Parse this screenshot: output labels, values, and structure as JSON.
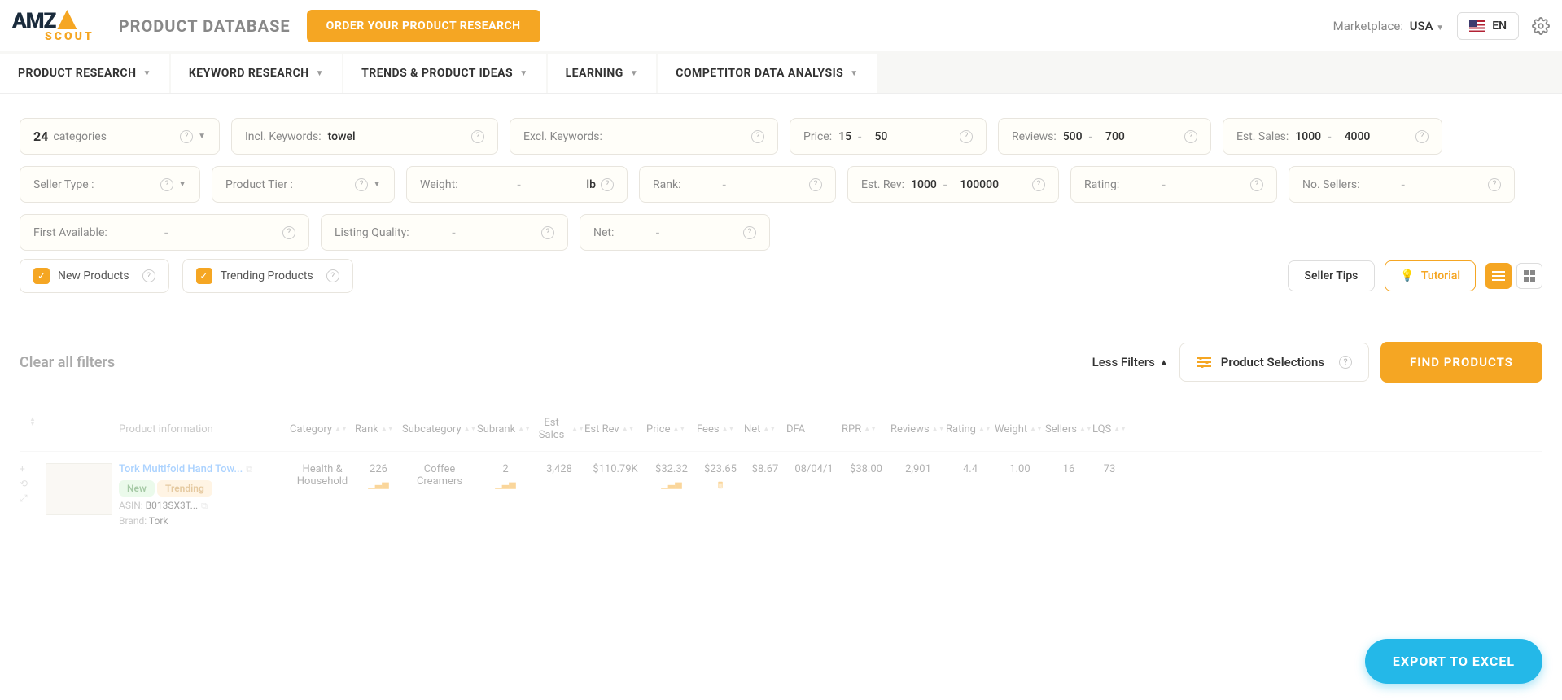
{
  "header": {
    "logo_text1": "AMZ",
    "logo_text2": "SCOUT",
    "page_title": "PRODUCT DATABASE",
    "order_btn": "ORDER YOUR PRODUCT RESEARCH",
    "marketplace_label": "Marketplace:",
    "marketplace_value": "USA",
    "lang": "EN"
  },
  "nav": {
    "items": [
      "PRODUCT RESEARCH",
      "KEYWORD RESEARCH",
      "TRENDS & PRODUCT IDEAS",
      "LEARNING",
      "COMPETITOR DATA ANALYSIS"
    ]
  },
  "filters": {
    "categories_count": "24",
    "categories_label": "categories",
    "incl_kw_label": "Incl. Keywords:",
    "incl_kw_value": "towel",
    "excl_kw_label": "Excl. Keywords:",
    "price_label": "Price:",
    "price_min": "15",
    "price_max": "50",
    "reviews_label": "Reviews:",
    "reviews_min": "500",
    "reviews_max": "700",
    "est_sales_label": "Est. Sales:",
    "est_sales_min": "1000",
    "est_sales_max": "4000",
    "seller_type_label": "Seller Type :",
    "product_tier_label": "Product Tier :",
    "weight_label": "Weight:",
    "weight_unit": "lb",
    "rank_label": "Rank:",
    "est_rev_label": "Est. Rev:",
    "est_rev_min": "1000",
    "est_rev_max": "100000",
    "rating_label": "Rating:",
    "no_sellers_label": "No. Sellers:",
    "first_avail_label": "First Available:",
    "listing_quality_label": "Listing Quality:",
    "net_label": "Net:"
  },
  "checkboxes": {
    "new_products": "New Products",
    "trending_products": "Trending Products",
    "seller_tips": "Seller Tips",
    "tutorial": "Tutorial"
  },
  "actions": {
    "clear_filters": "Clear all filters",
    "less_filters": "Less Filters",
    "product_selections": "Product Selections",
    "find_products": "FIND PRODUCTS"
  },
  "table": {
    "headers": {
      "product_info": "Product information",
      "category": "Category",
      "rank": "Rank",
      "subcategory": "Subcategory",
      "subrank": "Subrank",
      "est_sales": "Est Sales",
      "est_rev": "Est Rev",
      "price": "Price",
      "fees": "Fees",
      "net": "Net",
      "dfa": "DFA",
      "rpr": "RPR",
      "reviews": "Reviews",
      "rating": "Rating",
      "weight": "Weight",
      "sellers": "Sellers",
      "lqs": "LQS"
    },
    "row": {
      "product_name": "Tork Multifold Hand Tow...",
      "badge_new": "New",
      "badge_trending": "Trending",
      "asin_label": "ASIN:",
      "asin_value": "B013SX3T...",
      "brand_label": "Brand:",
      "brand_value": "Tork",
      "category": "Health & Household",
      "rank": "226",
      "subcategory": "Coffee Creamers",
      "subrank": "2",
      "est_sales": "3,428",
      "est_rev": "$110.79K",
      "price": "$32.32",
      "fees": "$23.65",
      "net": "$8.67",
      "dfa": "08/04/1",
      "rpr": "$38.00",
      "reviews": "2,901",
      "rating": "4.4",
      "weight": "1.00",
      "sellers": "16",
      "lqs": "73"
    }
  },
  "export_btn": "EXPORT TO EXCEL"
}
